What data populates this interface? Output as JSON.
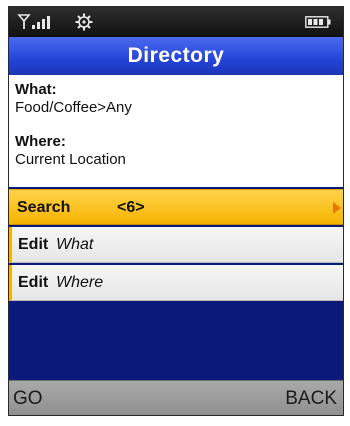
{
  "status_bar": {
    "signal_icon": "signal-strength-icon",
    "settings_icon": "gear-icon",
    "battery_icon": "battery-icon"
  },
  "header": {
    "title": "Directory"
  },
  "query": {
    "what_label": "What:",
    "what_value": "Food/Coffee>Any",
    "where_label": "Where:",
    "where_value": "Current Location"
  },
  "menu": {
    "search": {
      "label": "Search",
      "count": "<6>"
    },
    "edit_what": {
      "verb": "Edit",
      "object": "What"
    },
    "edit_where": {
      "verb": "Edit",
      "object": "Where"
    }
  },
  "softkeys": {
    "left": "GO",
    "right": "BACK"
  },
  "colors": {
    "title_bar": "#2444d8",
    "highlight": "#f6b400",
    "background": "#0b1a7a",
    "softkey_bar": "#9c9c9c"
  }
}
